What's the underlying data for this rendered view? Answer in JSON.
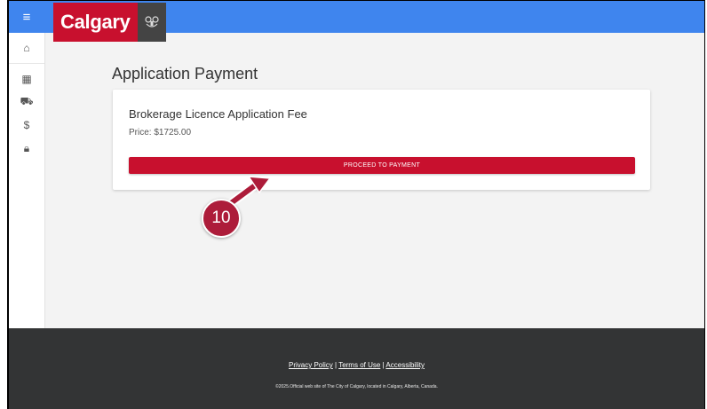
{
  "header": {
    "menu_icon": "hamburger-menu-icon",
    "logo_text": "Calgary",
    "crest_icon": "city-crest-icon",
    "colors": {
      "topbar": "#3f85ee",
      "brand_red": "#c8102e"
    }
  },
  "sidebar": {
    "items": [
      {
        "icon": "home-icon",
        "glyph": "⌂"
      },
      {
        "icon": "building-icon",
        "glyph": "▦"
      },
      {
        "icon": "vehicle-icon",
        "glyph": "⛟"
      },
      {
        "icon": "dollar-icon",
        "glyph": "$"
      },
      {
        "icon": "lock-icon",
        "glyph": "🔒︎"
      }
    ]
  },
  "main": {
    "page_title": "Application Payment",
    "card": {
      "title": "Brokerage Licence Application Fee",
      "price": "Price: $1725.00",
      "button_label": "PROCEED TO PAYMENT"
    },
    "annotation": {
      "step_number": "10",
      "color": "#ad1c3a"
    }
  },
  "footer": {
    "links": [
      "Privacy Policy",
      "Terms of Use",
      "Accessibility"
    ],
    "separator": "|",
    "copyright": "©2025.Official web site of The City of Calgary, located in Calgary, Alberta, Canada."
  }
}
